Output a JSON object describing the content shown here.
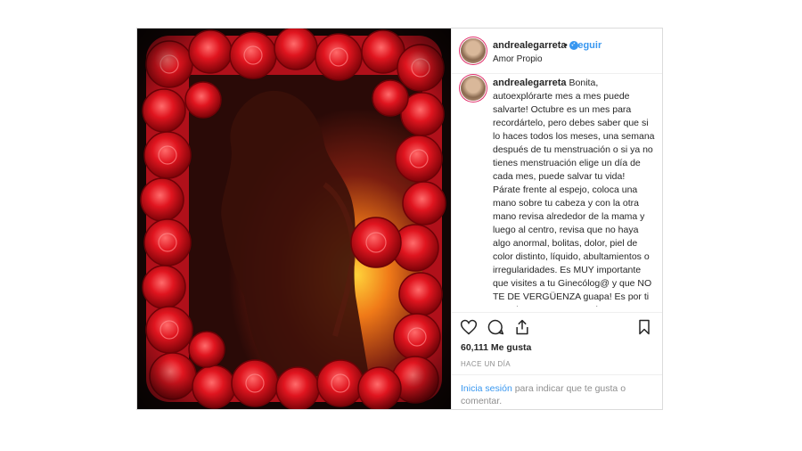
{
  "post": {
    "username": "andrealegarreta",
    "follow_label": "Seguir",
    "location": "Amor Propio",
    "caption": "Bonita, autoexplórarte mes a mes puede salvarte! Octubre es un mes para recordártelo, pero debes saber que si lo haces todos los meses, una semana después de tu menstruación o si ya no tienes menstruación elige un día de cada mes, puede salvar tu vida! Párate frente al espejo, coloca una mano sobre tu cabeza y con la otra mano revisa alrededor de la mama y luego al centro, revisa que no haya algo anormal, bolitas, dolor, piel de color distinto, líquido, abultamientos o irregularidades. Es MUY importante que visites a tu Ginecólog@ y que NO TE DE VERGÜENZA guapa! Es por ti y por los que te aman! Tócate y toca tu vida! 🎀 Y a ti, que lo estás viviendo, te deseo pronto salgas de esta batalla... Voy a salir adelante de la mano de",
    "likes": "60,111 Me gusta",
    "time": "HACE UN DÍA",
    "login_link": "Inicia sesión",
    "login_text": " para indicar que te gusta o comentar."
  },
  "icons": {
    "like": "heart-icon",
    "comment": "comment-icon",
    "share": "share-icon",
    "save": "bookmark-icon",
    "verified": "verified-badge-icon"
  },
  "colors": {
    "accent": "#3897f0",
    "rose": "#d4141c",
    "text": "#262626",
    "muted": "#8e8e8e"
  }
}
